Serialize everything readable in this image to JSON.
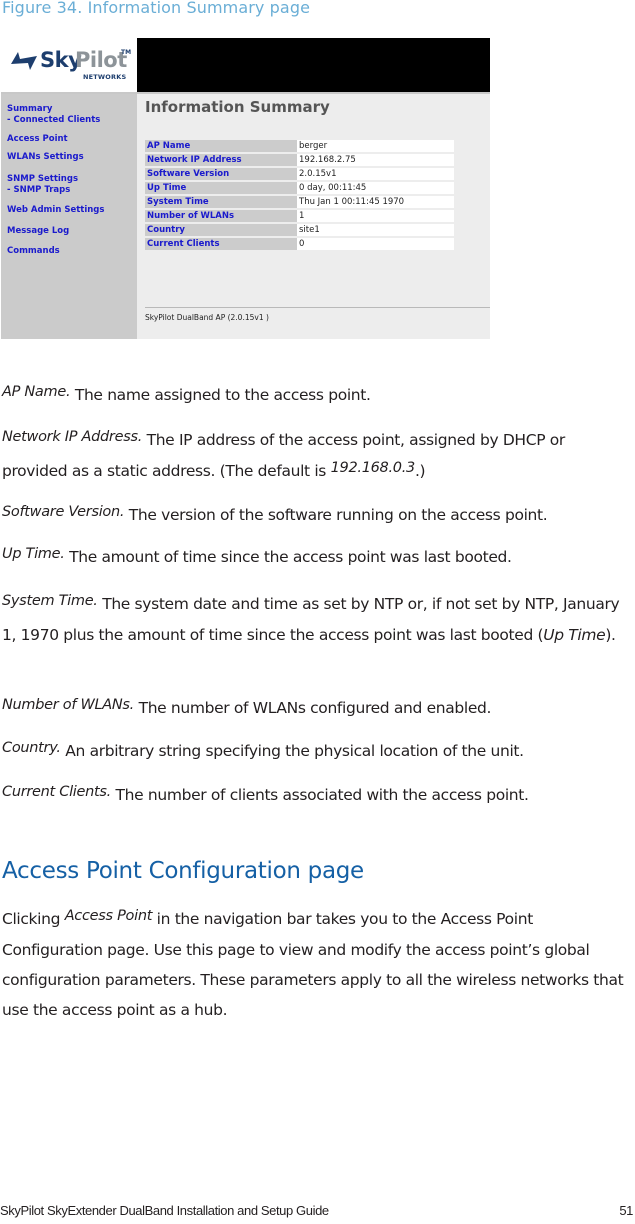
{
  "figure_caption": "Figure 34. Information Summary page",
  "screenshot": {
    "logo": {
      "brand_primary": "Sky",
      "brand_secondary": "Pilot",
      "trademark": "TM",
      "subtitle": "NETWORKS",
      "icon": "skypilot-wing-icon",
      "colors": {
        "navy": "#1d3e6e",
        "gray": "#8d9499"
      }
    },
    "nav": {
      "items": [
        {
          "label": "Summary"
        },
        {
          "label": "- Connected Clients"
        },
        {
          "label": "Access Point"
        },
        {
          "label": "WLANs Settings"
        },
        {
          "label": "SNMP Settings"
        },
        {
          "label": "- SNMP Traps"
        },
        {
          "label": "Web Admin Settings"
        },
        {
          "label": "Message Log"
        },
        {
          "label": "Commands"
        }
      ],
      "link_color": "#1a1acc"
    },
    "page_title": "Information Summary",
    "rows": [
      {
        "label": "AP Name",
        "value": "berger"
      },
      {
        "label": "Network IP Address",
        "value": "192.168.2.75"
      },
      {
        "label": "Software Version",
        "value": "2.0.15v1"
      },
      {
        "label": "Up Time",
        "value": "0 day, 00:11:45"
      },
      {
        "label": "System Time",
        "value": "Thu Jan 1 00:11:45 1970"
      },
      {
        "label": "Number of WLANs",
        "value": "1"
      },
      {
        "label": "Country",
        "value": "site1"
      },
      {
        "label": "Current Clients",
        "value": "0"
      }
    ],
    "footer": "SkyPilot DualBand AP (2.0.15v1 )"
  },
  "definitions": [
    {
      "term": "AP Name.",
      "text": " The name assigned to the access point."
    },
    {
      "term": "Network IP Address.",
      "text": " The IP address of the access point, assigned by DHCP or provided as a static address. (The default is ",
      "inline_term": "192.168.0.3",
      "text_after": ".)"
    },
    {
      "term": "Software Version.",
      "text": " The version of the software running on the access point."
    },
    {
      "term": "Up Time.",
      "text": " The amount of time since the access point was last booted."
    },
    {
      "term": "System Time.",
      "text": " The system date and time as set by NTP or, if not set by NTP, January 1, 1970 plus the amount of time since the access point was last booted (",
      "inline_term": "Up Time",
      "text_after": ")."
    },
    {
      "term": "Number of WLANs.",
      "text": " The number of WLANs configured and enabled."
    },
    {
      "term": "Country.",
      "text": " An arbitrary string specifying the physical location of the unit."
    },
    {
      "term": "Current Clients.",
      "text": " The number of clients associated with the access point."
    }
  ],
  "section": {
    "heading": "Access Point Configuration page",
    "intro_before": "Clicking ",
    "intro_term": "Access Point",
    "intro_after": " in the navigation bar takes you to the Access Point Configuration page. Use this page to view and modify the access point’s global configuration parameters. These parameters apply to all the wireless networks that use the access point as a hub."
  },
  "page_footer": {
    "title": "SkyPilot SkyExtender DualBand Installation and Setup Guide",
    "page_number": "51"
  },
  "colors": {
    "caption": "#6aaed6",
    "heading": "#1560a5",
    "body_text": "#231f20"
  }
}
